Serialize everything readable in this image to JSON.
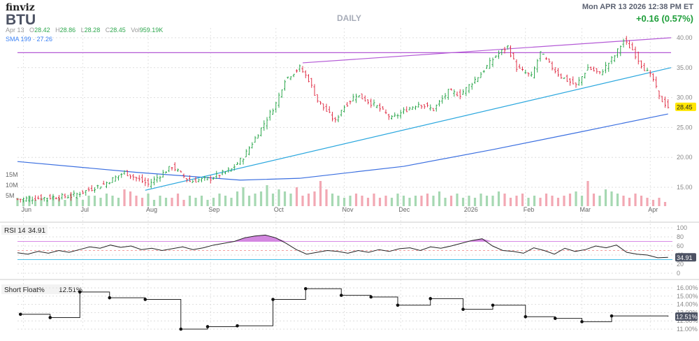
{
  "header": {
    "logo": "finviz",
    "ticker": "BTU",
    "period": "DAILY",
    "datetime": "Mon APR 13 2026 12:38 PM ET",
    "change": "+0.16 (0.57%)",
    "ohlc": {
      "date": "Apr 13",
      "o_label": "O",
      "open": "28.42",
      "h_label": "H",
      "high": "28.86",
      "l_label": "L",
      "low": "28.28",
      "c_label": "C",
      "close": "28.45",
      "v_label": "Vol",
      "volume": "959.19K"
    },
    "sma_label": "SMA 199 · 27.26"
  },
  "colors": {
    "up": "#2fa84f",
    "down": "#e0344b",
    "sma": "#3b6fe0",
    "trend_cyan": "#2aa7de",
    "trend_purple": "#b45ad6",
    "rsi_fill": "#c86ad8"
  },
  "chart_data": [
    {
      "type": "line",
      "name": "price",
      "title": "BTU DAILY",
      "ylim": [
        12,
        41
      ],
      "yticks": [
        "40.00",
        "35.00",
        "30.00",
        "25.00",
        "20.00",
        "15.00"
      ],
      "ytick_values": [
        40,
        35,
        30,
        25,
        20,
        15
      ],
      "xticks": [
        {
          "label": "Jun",
          "i": 2
        },
        {
          "label": "Jul",
          "i": 22
        },
        {
          "label": "Aug",
          "i": 44
        },
        {
          "label": "Sep",
          "i": 65
        },
        {
          "label": "Oct",
          "i": 87
        },
        {
          "label": "Nov",
          "i": 110
        },
        {
          "label": "Dec",
          "i": 129
        },
        {
          "label": "2026",
          "i": 151
        },
        {
          "label": "Feb",
          "i": 171
        },
        {
          "label": "Mar",
          "i": 190
        },
        {
          "label": "Apr",
          "i": 213
        }
      ],
      "price_path": [
        [
          0,
          13
        ],
        [
          18,
          13.5
        ],
        [
          29,
          15.5
        ],
        [
          36,
          17.5
        ],
        [
          44,
          15.5
        ],
        [
          52,
          18.5
        ],
        [
          58,
          16
        ],
        [
          65,
          16.5
        ],
        [
          72,
          18
        ],
        [
          76,
          20
        ],
        [
          81,
          24
        ],
        [
          87,
          29
        ],
        [
          90,
          33
        ],
        [
          95,
          35
        ],
        [
          98,
          33
        ],
        [
          101,
          29.5
        ],
        [
          107,
          26
        ],
        [
          109,
          28
        ],
        [
          114,
          30.5
        ],
        [
          121,
          28.5
        ],
        [
          126,
          26.5
        ],
        [
          131,
          28
        ],
        [
          135,
          29
        ],
        [
          140,
          28
        ],
        [
          145,
          31
        ],
        [
          149,
          30.5
        ],
        [
          156,
          34
        ],
        [
          161,
          37
        ],
        [
          165,
          38.5
        ],
        [
          168,
          35
        ],
        [
          173,
          33.5
        ],
        [
          176,
          37.5
        ],
        [
          180,
          35
        ],
        [
          183,
          33.5
        ],
        [
          188,
          32
        ],
        [
          192,
          35
        ],
        [
          196,
          34
        ],
        [
          201,
          37
        ],
        [
          204,
          39.5
        ],
        [
          207,
          38
        ],
        [
          210,
          35.5
        ],
        [
          214,
          33
        ],
        [
          216,
          30
        ],
        [
          219,
          28.45
        ]
      ],
      "last_price": "28.45",
      "sma199": [
        [
          0,
          19.3
        ],
        [
          40,
          17.5
        ],
        [
          75,
          16.2
        ],
        [
          95,
          16.5
        ],
        [
          130,
          18.5
        ],
        [
          160,
          21.3
        ],
        [
          190,
          24.3
        ],
        [
          219,
          27.26
        ]
      ],
      "trendlines": [
        {
          "color": "purple",
          "from": [
            0,
            37.5
          ],
          "to": [
            220,
            37.5
          ]
        },
        {
          "color": "purple",
          "from": [
            96,
            35.8
          ],
          "to": [
            220,
            40
          ]
        },
        {
          "color": "cyan",
          "from": [
            43,
            14.5
          ],
          "to": [
            220,
            35
          ]
        }
      ]
    },
    {
      "type": "bar",
      "name": "volume",
      "yticks": [
        "15M",
        "10M",
        "5M"
      ],
      "ytick_values": [
        15,
        10,
        5
      ],
      "values": [
        4,
        3,
        5,
        3,
        4,
        3,
        5,
        4,
        3,
        6,
        4,
        3,
        5,
        5,
        4,
        6,
        5,
        4,
        8,
        7,
        5,
        4,
        6,
        3,
        5,
        4,
        4,
        6,
        3,
        5,
        4,
        5,
        3,
        4,
        6,
        5,
        4,
        7,
        9,
        5,
        6,
        7,
        10,
        6,
        8,
        7,
        6,
        9,
        5,
        6,
        7,
        12,
        8,
        6,
        5,
        4,
        5,
        6,
        5,
        4,
        6,
        4,
        5,
        4,
        6,
        5,
        4,
        5,
        5,
        6,
        5,
        7,
        4,
        5,
        6,
        4,
        5,
        4,
        6,
        5,
        5,
        7,
        6,
        4,
        5,
        6,
        4,
        5,
        4,
        6,
        5,
        4,
        5,
        6,
        7,
        5,
        12,
        6,
        5,
        8,
        7,
        6,
        5,
        4,
        6,
        5,
        4,
        3,
        4,
        2
      ]
    },
    {
      "type": "line",
      "name": "RSI 14",
      "value": "34.91",
      "ylim": [
        0,
        100
      ],
      "yticks": [
        "100",
        "80",
        "60",
        "40",
        "20",
        "0"
      ],
      "ytick_values": [
        100,
        80,
        60,
        40,
        20,
        0
      ],
      "overbought": 70,
      "oversold": 30,
      "values": [
        45,
        42,
        48,
        44,
        50,
        46,
        52,
        58,
        55,
        62,
        57,
        60,
        52,
        55,
        50,
        54,
        58,
        52,
        56,
        62,
        66,
        70,
        78,
        82,
        84,
        78,
        66,
        52,
        42,
        46,
        50,
        48,
        44,
        50,
        46,
        52,
        48,
        54,
        56,
        50,
        58,
        55,
        60,
        66,
        72,
        76,
        60,
        50,
        48,
        44,
        56,
        50,
        42,
        55,
        48,
        52,
        60,
        56,
        62,
        46,
        42,
        40,
        34,
        35
      ]
    },
    {
      "type": "step",
      "name": "Short Float%",
      "value": "12.51%",
      "ylim": [
        10.7,
        16.3
      ],
      "yticks": [
        "16.00%",
        "15.00%",
        "14.00%",
        "13.00%",
        "12.00%",
        "11.00%"
      ],
      "ytick_values": [
        16,
        15,
        14,
        13,
        12,
        11
      ],
      "points": [
        [
          1,
          12.8
        ],
        [
          11,
          12.4
        ],
        [
          21,
          15.5
        ],
        [
          31,
          14.8
        ],
        [
          43,
          14.6
        ],
        [
          55,
          11.0
        ],
        [
          64,
          11.3
        ],
        [
          74,
          11.4
        ],
        [
          86,
          14.6
        ],
        [
          97,
          15.9
        ],
        [
          109,
          15.1
        ],
        [
          119,
          14.9
        ],
        [
          128,
          13.9
        ],
        [
          139,
          14.7
        ],
        [
          150,
          13.4
        ],
        [
          160,
          13.9
        ],
        [
          171,
          12.5
        ],
        [
          181,
          12.3
        ],
        [
          190,
          11.9
        ],
        [
          200,
          12.6
        ],
        [
          219,
          12.51
        ]
      ]
    }
  ]
}
